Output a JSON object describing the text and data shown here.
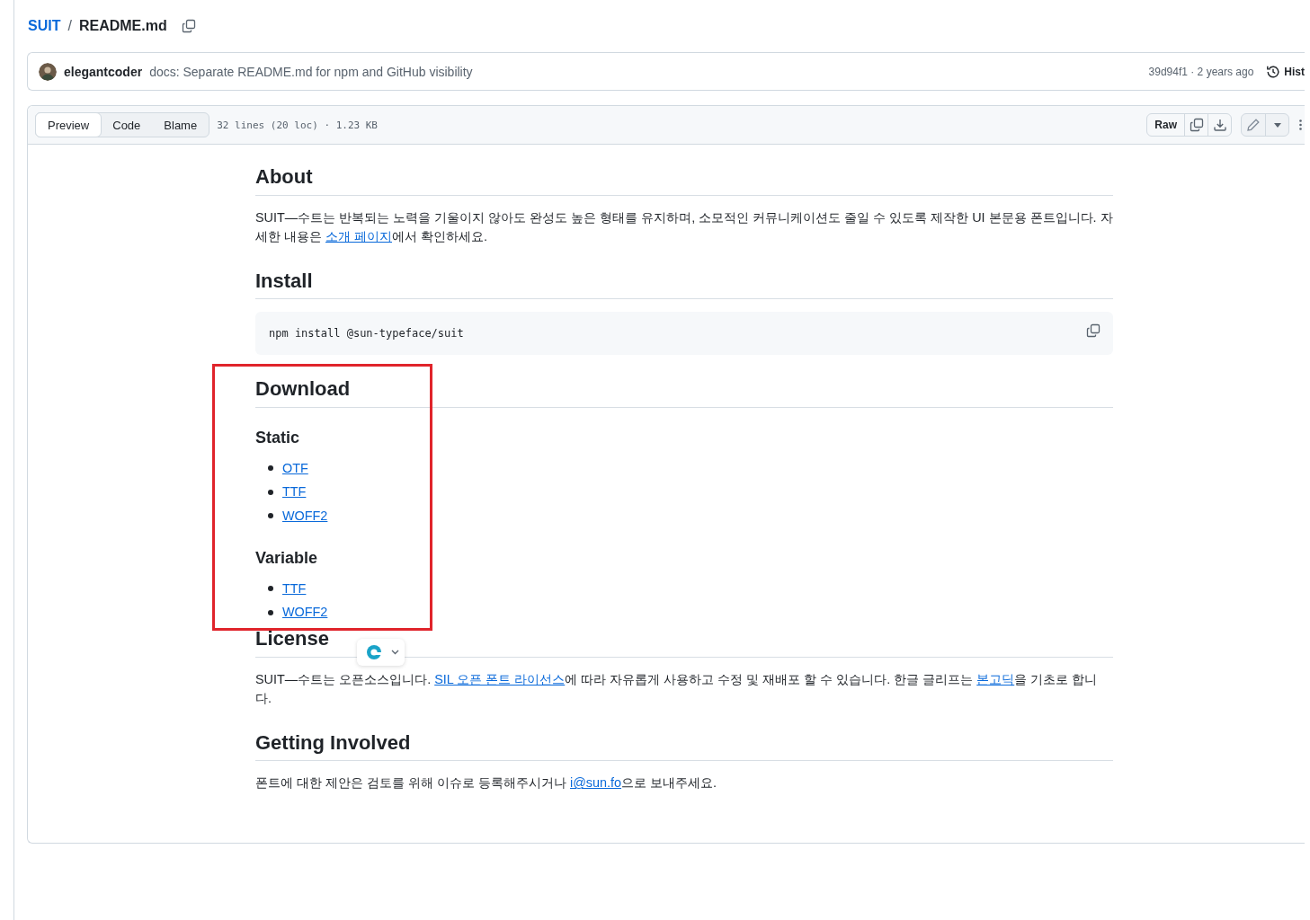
{
  "breadcrumb": {
    "repo": "SUIT",
    "separator": "/",
    "file": "README.md"
  },
  "commit": {
    "author": "elegantcoder",
    "message": "docs: Separate README.md for npm and GitHub visibility",
    "meta": "39d94f1 · 2 years ago",
    "history": "Hist"
  },
  "tabs": [
    {
      "label": "Preview",
      "selected": true
    },
    {
      "label": "Code",
      "selected": false
    },
    {
      "label": "Blame",
      "selected": false
    }
  ],
  "file_info": "32 lines (20 loc) · 1.23 KB",
  "raw_button": "Raw",
  "sections": [
    {
      "title": "About",
      "highlighted": false,
      "blocks": [
        {
          "kind": "paragraph",
          "parts": [
            {
              "text": "SUIT—수트는 반복되는 노력을 기울이지 않아도 완성도 높은 형태를 유지하며, 소모적인 커뮤니케이션도 줄일 수 있도록 제작한 UI 본문용 폰트입니다. 자세한 내용은 "
            },
            {
              "link": "소개 페이지"
            },
            {
              "text": "에서 확인하세요."
            }
          ]
        }
      ]
    },
    {
      "title": "Install",
      "highlighted": false,
      "blocks": [
        {
          "kind": "code",
          "text": "npm install @sun-typeface/suit"
        }
      ]
    },
    {
      "title": "Download",
      "highlighted": true,
      "blocks": [
        {
          "kind": "subheading",
          "text": "Static"
        },
        {
          "kind": "list",
          "items": [
            "OTF",
            "TTF",
            "WOFF2"
          ]
        },
        {
          "kind": "subheading",
          "text": "Variable"
        },
        {
          "kind": "list",
          "items": [
            "TTF",
            "WOFF2"
          ]
        }
      ]
    },
    {
      "title": "License",
      "highlighted": false,
      "blocks": [
        {
          "kind": "paragraph",
          "parts": [
            {
              "text": "SUIT—수트는 오픈소스입니다. "
            },
            {
              "link": "SIL 오픈 폰트 라이선스"
            },
            {
              "text": "에 따라 자유롭게 사용하고 수정 및 재배포 할 수 있습니다. 한글 글리프는 "
            },
            {
              "link": "본고딕"
            },
            {
              "text": "을 기초로 합니다."
            }
          ]
        }
      ]
    },
    {
      "title": "Getting Involved",
      "highlighted": false,
      "blocks": [
        {
          "kind": "paragraph",
          "parts": [
            {
              "text": "폰트에 대한 제안은 검토를 위해 이슈로 등록해주시거나 "
            },
            {
              "link": "i@sun.fo"
            },
            {
              "text": "으로 보내주세요."
            }
          ]
        }
      ]
    }
  ]
}
